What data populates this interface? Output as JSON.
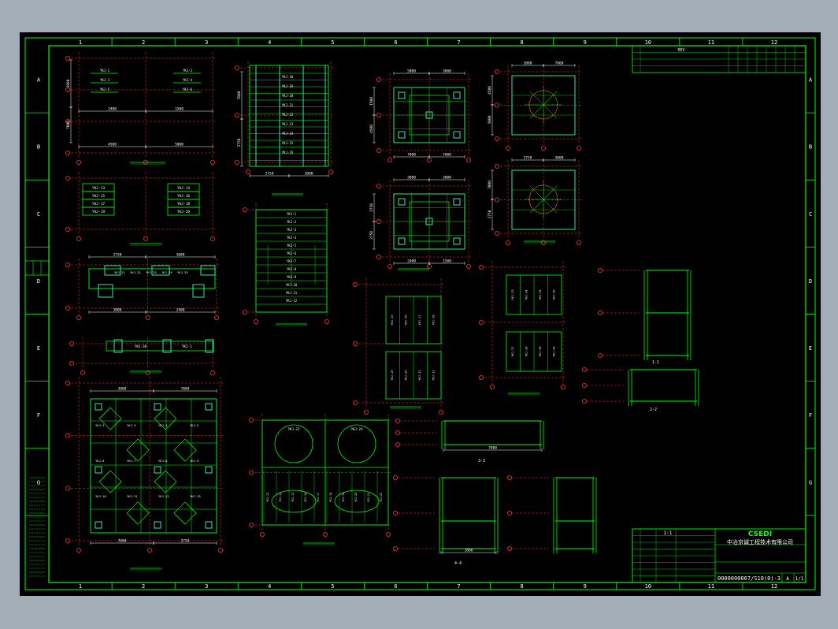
{
  "colors": {
    "background": "#000000",
    "frame": "#00ff00",
    "grid": "#00ff00",
    "axis": "#ff3030",
    "dimension": "#ffffff",
    "member": "#33ffcc",
    "text": "#ffffff"
  },
  "columns_top": [
    "1",
    "2",
    "3",
    "4",
    "5",
    "6",
    "7",
    "8",
    "9",
    "10",
    "11",
    "12"
  ],
  "columns_bottom": [
    "1",
    "2",
    "3",
    "4",
    "5",
    "6",
    "7",
    "8",
    "9",
    "10",
    "11",
    "12"
  ],
  "rows_left": [
    "A",
    "B",
    "C",
    "D",
    "E",
    "F",
    "G"
  ],
  "rows_right": [
    "A",
    "B",
    "C",
    "D",
    "E",
    "F",
    "G"
  ],
  "title_block": {
    "company": "CSEDI",
    "company_cn": "中冶京诚工程技术有限公司",
    "drawing_no": "0000000067/S10(0)-3",
    "sheet": "1/1",
    "scale": "1:1",
    "rev": "A"
  },
  "plates": [
    "YKJ-1",
    "YKJ-2",
    "YKJ-3",
    "YKJ-4",
    "YKJ-5",
    "YKJ-6",
    "YKJ-7",
    "YKJ-8",
    "YKJ-9",
    "YKJ-10",
    "YKJ-11",
    "YKJ-12",
    "YKJ-13",
    "YKJ-14",
    "YKJ-15",
    "YKJ-16",
    "YKJ-17",
    "YKJ-18",
    "YKJ-19",
    "YKJ-20",
    "YKJ-21",
    "YKJ-22",
    "YKJ-23",
    "YKJ-24",
    "YKJ-25",
    "YKJ-26",
    "YKJ-27",
    "YKJ-28",
    "YKJ-29",
    "YKJ-30"
  ],
  "dims": [
    "7000",
    "7000",
    "2750",
    "2750",
    "3000",
    "3000",
    "2400",
    "1500",
    "4500",
    "5000",
    "3800"
  ],
  "section_labels": [
    "1-1",
    "2-2",
    "3-3",
    "4-4"
  ]
}
